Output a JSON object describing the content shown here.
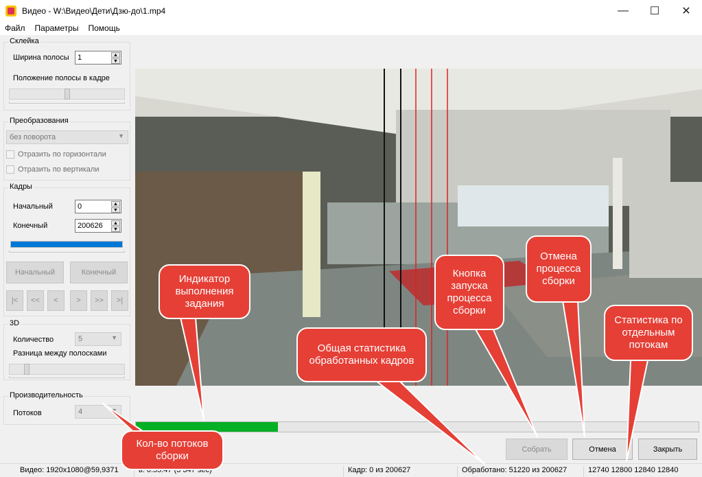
{
  "window": {
    "title": "Видео - W:\\Видео\\Дети\\Дзю-до\\1.mp4",
    "minimize": "—",
    "maximize": "☐",
    "close": "✕"
  },
  "menu": [
    "Файл",
    "Параметры",
    "Помощь"
  ],
  "skleika": {
    "group_label": "Склейка",
    "stripe_width_label": "Ширина полосы",
    "stripe_width_value": "1",
    "stripe_position_label": "Положение полосы в кадре"
  },
  "transform": {
    "group_label": "Преобразования",
    "rotation_value": "без поворота",
    "flip_h_label": "Отразить по горизонтали",
    "flip_v_label": "Отразить по вертикали"
  },
  "frames": {
    "group_label": "Кадры",
    "start_label": "Начальный",
    "start_value": "0",
    "end_label": "Конечный",
    "end_value": "200626",
    "start_button": "Начальный",
    "end_button": "Конечный",
    "nav": [
      "|<",
      "<<",
      "<",
      ">",
      ">>",
      ">|"
    ]
  },
  "three_d": {
    "group_label": "3D",
    "count_label": "Количество",
    "count_value": "5",
    "diff_label": "Разница между полосками"
  },
  "performance": {
    "group_label": "Производительность",
    "threads_label": "Потоков",
    "threads_value": "4"
  },
  "progress": {
    "fraction": 0.253
  },
  "buttons": {
    "collect": "Собрать",
    "cancel": "Отмена",
    "close": "Закрыть"
  },
  "status": {
    "video": "Видео: 1920x1080@59,9371",
    "duration": "ь: 0:55:47 (3 347 sec)",
    "frame": "Кадр: 0 из 200627",
    "processed": "Обработано: 51220 из 200627",
    "threads_stats": "12740 12800 12840 12840"
  },
  "callouts": {
    "progress_indicator": "Индикатор выполнения задания",
    "general_stats": "Общая статистика обработанных кадров",
    "start_button": "Кнопка запуска процесса сборки",
    "cancel": "Отмена процесса сборки",
    "thread_stats": "Статистика по отдельным потокам",
    "threads_count": "Кол-во потоков сборки"
  },
  "colors": {
    "progress": "#06b025",
    "callout": "#e53f36",
    "video_stripe_red": "#e02020"
  }
}
